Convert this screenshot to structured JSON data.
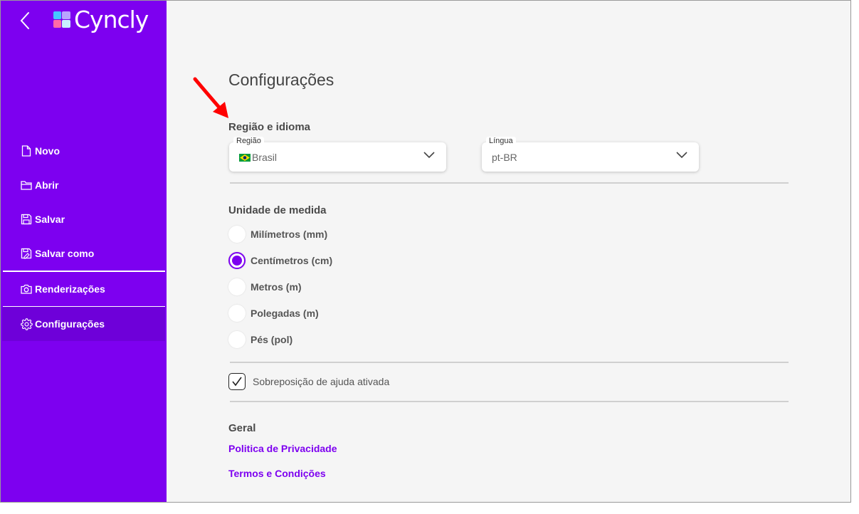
{
  "app": {
    "logo_text": "Cyncly"
  },
  "sidebar": {
    "items": [
      {
        "label": "Novo",
        "icon": "file-icon"
      },
      {
        "label": "Abrir",
        "icon": "folder-icon"
      },
      {
        "label": "Salvar",
        "icon": "save-icon"
      },
      {
        "label": "Salvar como",
        "icon": "save-as-icon"
      },
      {
        "label": "Renderizações",
        "icon": "camera-icon"
      },
      {
        "label": "Configurações",
        "icon": "gear-icon",
        "active": true
      }
    ]
  },
  "settings": {
    "title": "Configurações",
    "region_language": {
      "heading": "Região e idioma",
      "region": {
        "label": "Região",
        "value": "Brasil",
        "flag": "brazil-flag-icon"
      },
      "language": {
        "label": "Língua",
        "value": "pt-BR"
      }
    },
    "unit": {
      "heading": "Unidade de medida",
      "options": [
        {
          "label": "Milímetros (mm)",
          "selected": false
        },
        {
          "label": "Centímetros (cm)",
          "selected": true
        },
        {
          "label": "Metros (m)",
          "selected": false
        },
        {
          "label": "Polegadas (m)",
          "selected": false
        },
        {
          "label": "Pés (pol)",
          "selected": false
        }
      ]
    },
    "help_overlay": {
      "label": "Sobreposição de ajuda ativada",
      "checked": true
    },
    "general": {
      "heading": "Geral",
      "links": [
        "Politica de Privacidade",
        "Termos e Condições"
      ]
    }
  },
  "colors": {
    "brand": "#7d00f0",
    "brand_active": "#6e00d9",
    "annotation_arrow": "#ff0000"
  }
}
